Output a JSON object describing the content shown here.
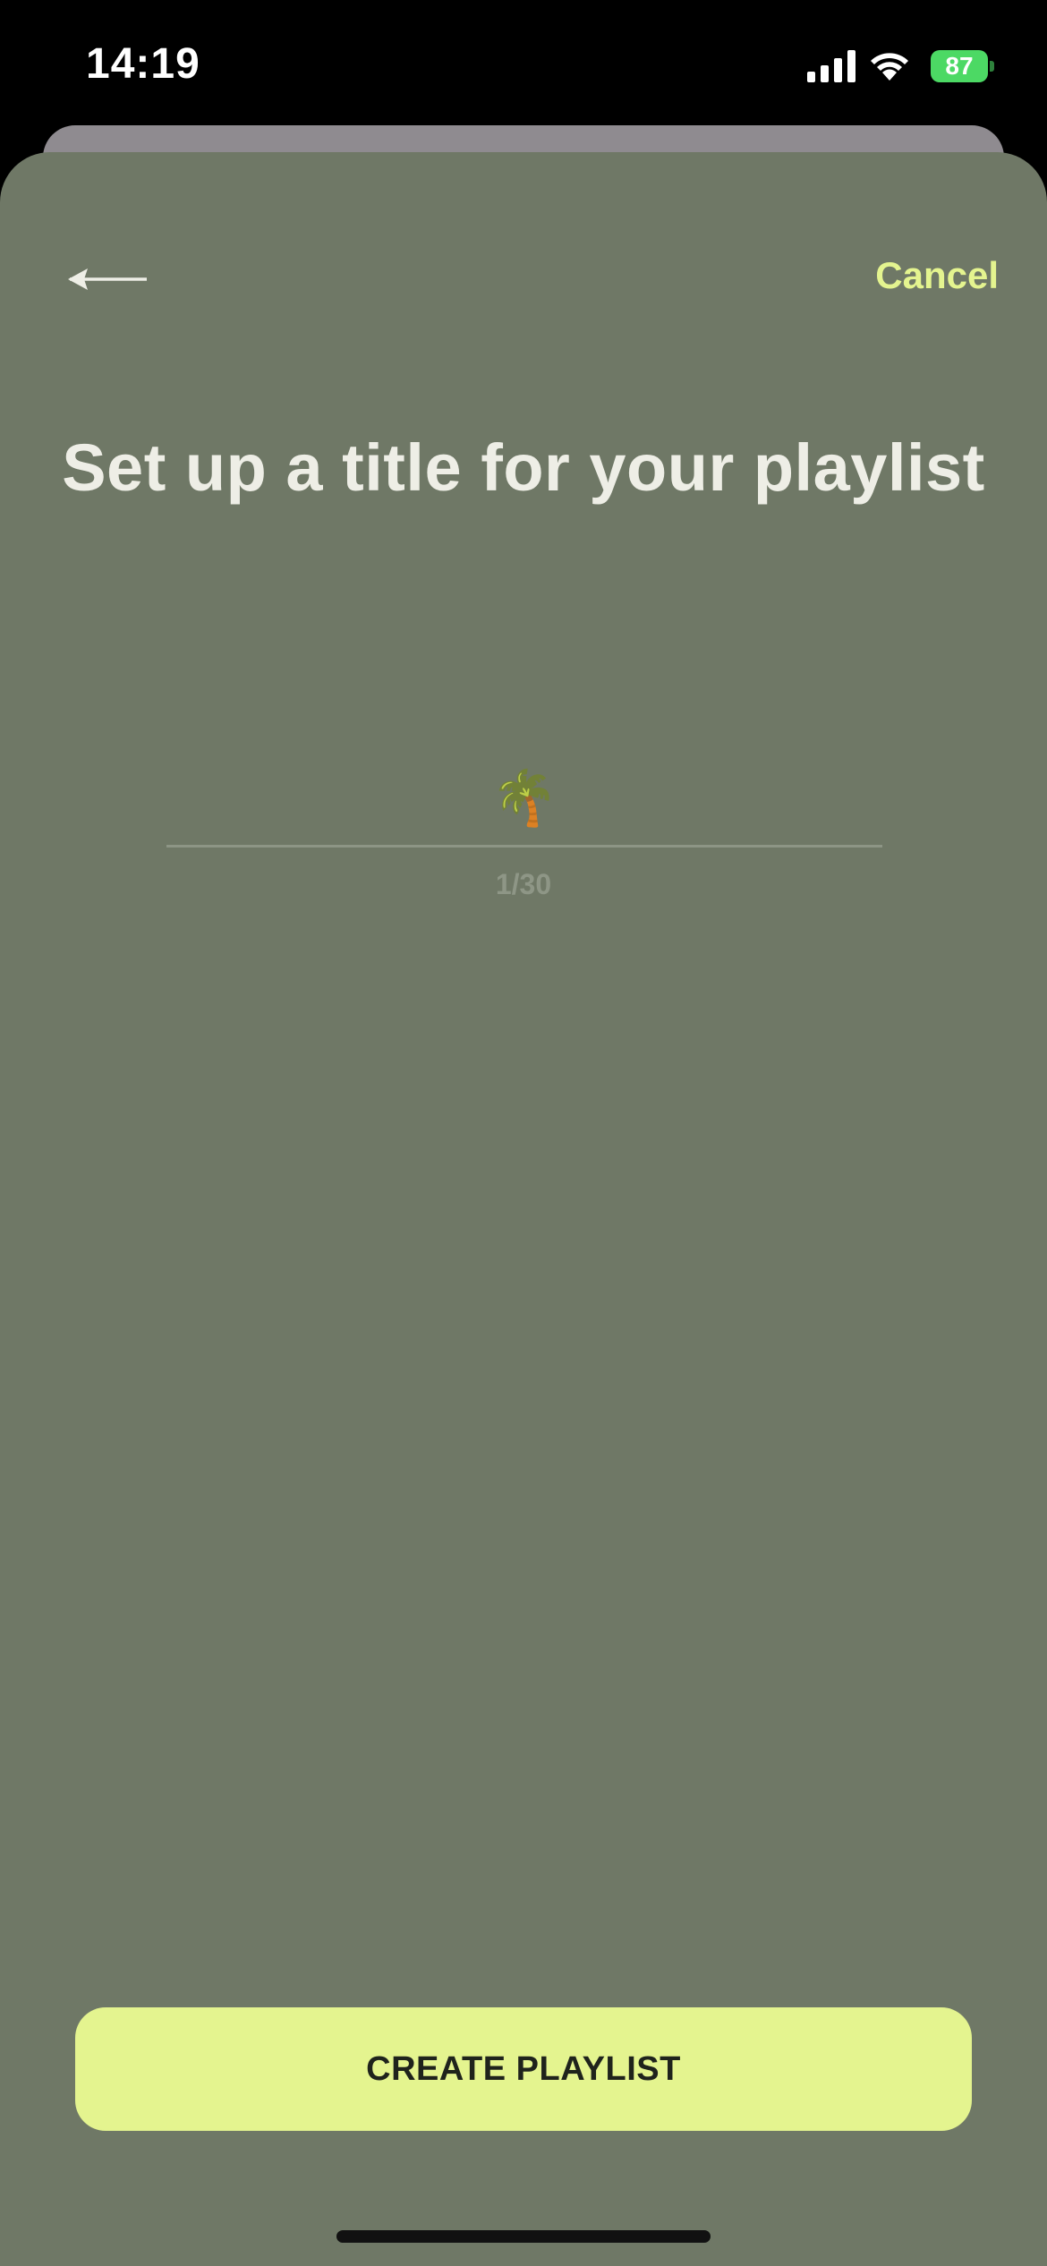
{
  "status_bar": {
    "time": "14:19",
    "battery": "87",
    "signal_icon": "signal-bars-icon",
    "wifi_icon": "wifi-icon"
  },
  "header": {
    "back_icon": "arrow-left-icon",
    "cancel_label": "Cancel"
  },
  "main": {
    "title": "Set up a title for your playlist",
    "name_input": {
      "value": "🌴"
    },
    "char_counter": "1/30"
  },
  "footer": {
    "create_label": "CREATE PLAYLIST"
  },
  "colors": {
    "sheet_background": "#6f7866",
    "accent": "#e4f48f",
    "title_text": "#eeeee6",
    "battery": "#4cd964"
  }
}
